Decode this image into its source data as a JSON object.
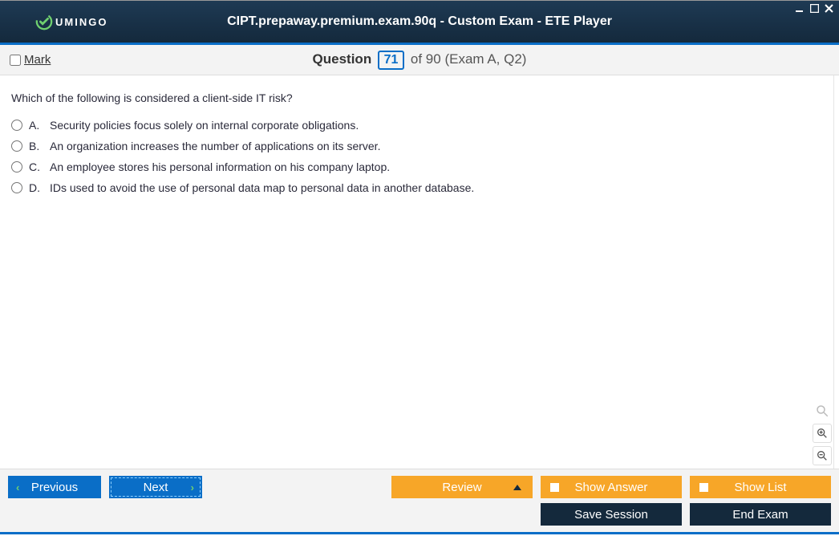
{
  "titlebar": {
    "brand": "UMINGO",
    "title": "CIPT.prepaway.premium.exam.90q - Custom Exam - ETE Player"
  },
  "infobar": {
    "mark_label": "Mark",
    "q_label": "Question",
    "q_number": "71",
    "q_of": "of 90 (Exam A, Q2)"
  },
  "question": {
    "text": "Which of the following is considered a client-side IT risk?",
    "answers": [
      {
        "letter": "A.",
        "text": "Security policies focus solely on internal corporate obligations."
      },
      {
        "letter": "B.",
        "text": "An organization increases the number of applications on its server."
      },
      {
        "letter": "C.",
        "text": "An employee stores his personal information on his company laptop."
      },
      {
        "letter": "D.",
        "text": "IDs used to avoid the use of personal data map to personal data in another database."
      }
    ]
  },
  "toolbar": {
    "prev": "Previous",
    "next": "Next",
    "review": "Review",
    "show_answer": "Show Answer",
    "show_list": "Show List",
    "save_session": "Save Session",
    "end_exam": "End Exam"
  }
}
